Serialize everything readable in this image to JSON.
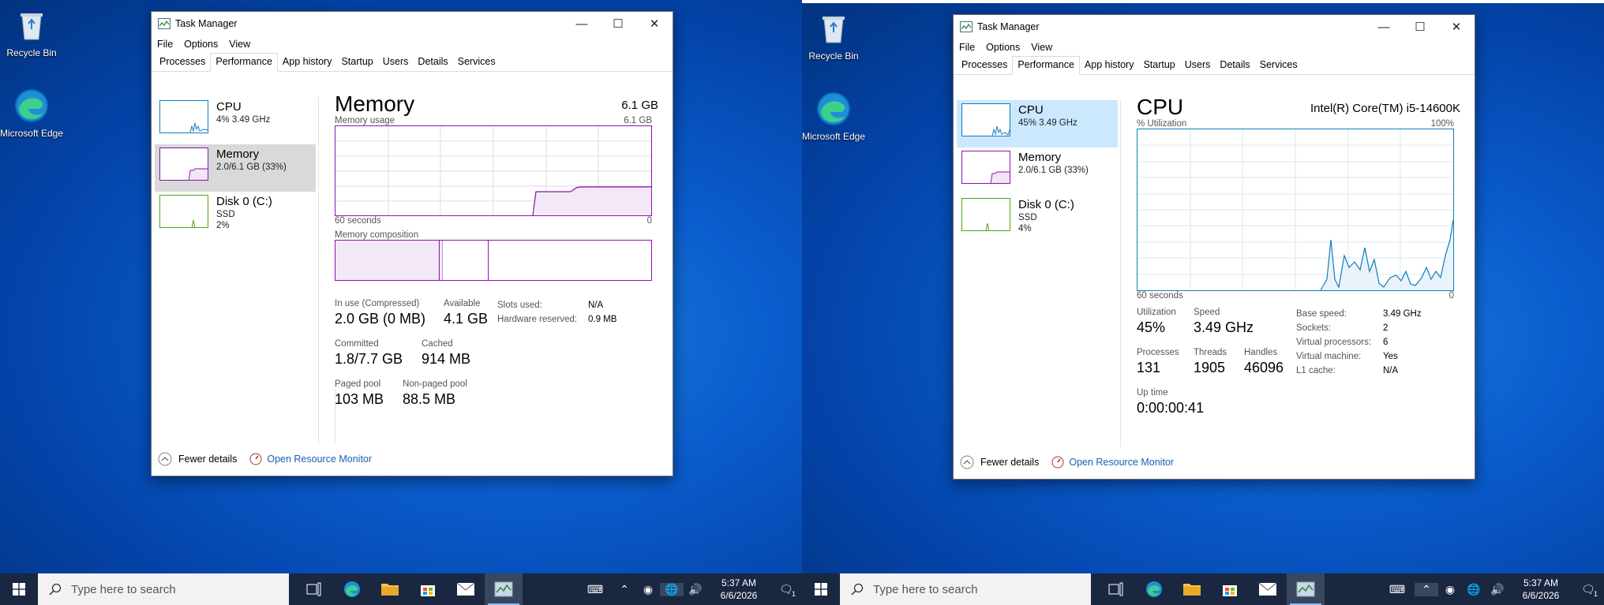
{
  "desktop": {
    "icons": [
      "Recycle Bin",
      "Microsoft Edge"
    ]
  },
  "left_window": {
    "title": "Task Manager",
    "menu": [
      "File",
      "Options",
      "View"
    ],
    "tabs": [
      "Processes",
      "Performance",
      "App history",
      "Startup",
      "Users",
      "Details",
      "Services"
    ],
    "sidebar": [
      {
        "name": "CPU",
        "sub1": "4% 3.49 GHz",
        "sub2": ""
      },
      {
        "name": "Memory",
        "sub1": "2.0/6.1 GB (33%)",
        "sub2": ""
      },
      {
        "name": "Disk 0 (C:)",
        "sub1": "SSD",
        "sub2": "2%"
      }
    ],
    "main": {
      "title": "Memory",
      "total": "6.1 GB",
      "usage_label": "Memory usage",
      "usage_max": "6.1 GB",
      "time_left": "60 seconds",
      "time_right": "0",
      "composition_label": "Memory composition",
      "stats": {
        "in_use_label": "In use (Compressed)",
        "in_use": "2.0 GB (0 MB)",
        "available_label": "Available",
        "available": "4.1 GB",
        "committed_label": "Committed",
        "committed": "1.8/7.7 GB",
        "cached_label": "Cached",
        "cached": "914 MB",
        "paged_label": "Paged pool",
        "paged": "103 MB",
        "nonpaged_label": "Non-paged pool",
        "nonpaged": "88.5 MB",
        "slots_label": "Slots used:",
        "slots": "N/A",
        "hwres_label": "Hardware reserved:",
        "hwres": "0.9 MB"
      }
    },
    "footer": {
      "fewer": "Fewer details",
      "monitor": "Open Resource Monitor"
    }
  },
  "right_window": {
    "title": "Task Manager",
    "menu": [
      "File",
      "Options",
      "View"
    ],
    "tabs": [
      "Processes",
      "Performance",
      "App history",
      "Startup",
      "Users",
      "Details",
      "Services"
    ],
    "sidebar": [
      {
        "name": "CPU",
        "sub1": "45% 3.49 GHz",
        "sub2": ""
      },
      {
        "name": "Memory",
        "sub1": "2.0/6.1 GB (33%)",
        "sub2": ""
      },
      {
        "name": "Disk 0 (C:)",
        "sub1": "SSD",
        "sub2": "4%"
      }
    ],
    "main": {
      "title": "CPU",
      "model": "Intel(R) Core(TM) i5-14600K",
      "util_label": "% Utilization",
      "util_max": "100%",
      "time_left": "60 seconds",
      "time_right": "0",
      "stats": {
        "utilization_label": "Utilization",
        "utilization": "45%",
        "speed_label": "Speed",
        "speed": "3.49 GHz",
        "processes_label": "Processes",
        "processes": "131",
        "threads_label": "Threads",
        "threads": "1905",
        "handles_label": "Handles",
        "handles": "46096",
        "uptime_label": "Up time",
        "uptime": "0:00:00:41",
        "base_speed_label": "Base speed:",
        "base_speed": "3.49 GHz",
        "sockets_label": "Sockets:",
        "sockets": "2",
        "vproc_label": "Virtual processors:",
        "vproc": "6",
        "vm_label": "Virtual machine:",
        "vm": "Yes",
        "l1_label": "L1 cache:",
        "l1": "N/A"
      }
    },
    "footer": {
      "fewer": "Fewer details",
      "monitor": "Open Resource Monitor"
    }
  },
  "taskbar": {
    "search_placeholder": "Type here to search",
    "time": "5:37 AM",
    "date": "6/6/2026",
    "notification_count": "1"
  },
  "colors": {
    "memory": "#8b12ae",
    "cpu": "#117dbb",
    "disk": "#4da60c",
    "link": "#1a5fb4"
  }
}
